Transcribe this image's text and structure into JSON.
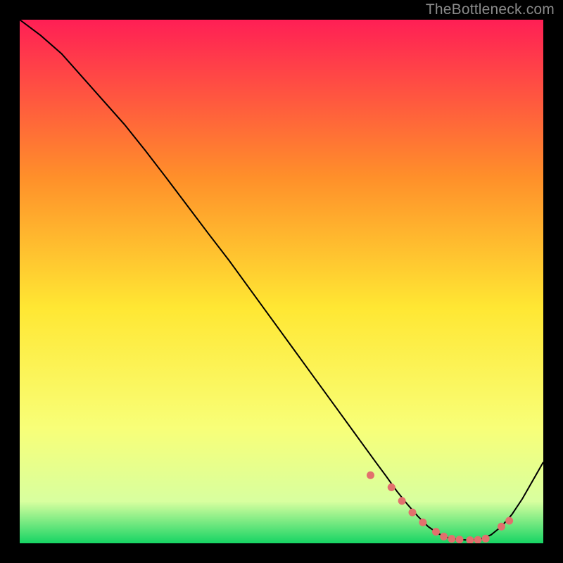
{
  "watermark": "TheBottleneck.com",
  "colors": {
    "bg": "#000000",
    "grad_top": "#ff1f55",
    "grad_mid1": "#ff8f2a",
    "grad_mid2": "#ffe733",
    "grad_mid3": "#f8ff78",
    "grad_low": "#d8ff9f",
    "grad_bottom": "#16d464",
    "curve": "#000000",
    "marker_fill": "#e2706d",
    "marker_stroke": "#e2706d"
  },
  "chart_data": {
    "type": "line",
    "title": "",
    "xlabel": "",
    "ylabel": "",
    "xlim": [
      0,
      100
    ],
    "ylim": [
      0,
      100
    ],
    "series": [
      {
        "name": "curve",
        "x": [
          0,
          4,
          8,
          12,
          16,
          20,
          24,
          28,
          32,
          36,
          40,
          44,
          48,
          52,
          56,
          60,
          64,
          68,
          70,
          72,
          74,
          76,
          78,
          80,
          82,
          84,
          86,
          88,
          90,
          92,
          94,
          96,
          100
        ],
        "y": [
          100,
          97,
          93.5,
          89,
          84.5,
          80,
          75,
          69.8,
          64.5,
          59.2,
          54,
          48.5,
          43,
          37.5,
          32,
          26.5,
          21,
          15.5,
          12.8,
          10,
          7.5,
          5.2,
          3.2,
          1.8,
          1,
          0.7,
          0.6,
          0.8,
          1.6,
          3.2,
          5.5,
          8.5,
          15.5
        ]
      }
    ],
    "markers": {
      "name": "highlight-points",
      "x": [
        67,
        71,
        73,
        75,
        77,
        79.5,
        81,
        82.5,
        84,
        86,
        87.5,
        89,
        92,
        93.5
      ],
      "y": [
        13.0,
        10.7,
        8.1,
        5.9,
        4.0,
        2.2,
        1.3,
        0.85,
        0.7,
        0.6,
        0.65,
        0.9,
        3.2,
        4.3
      ]
    }
  }
}
